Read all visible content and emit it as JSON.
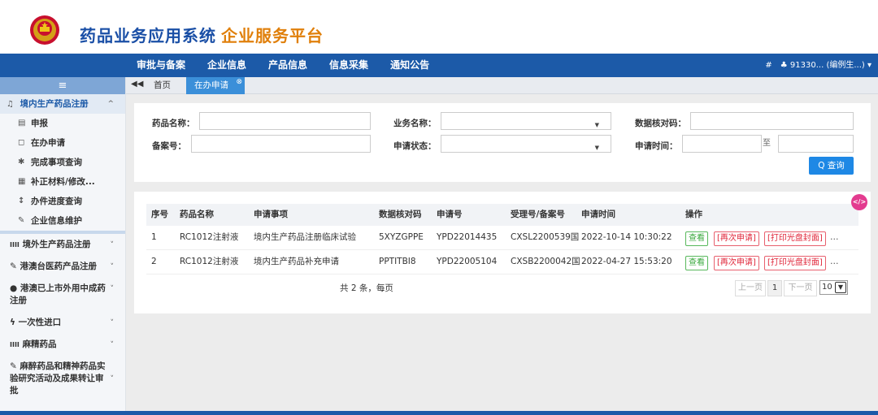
{
  "header": {
    "title": "药品业务应用系统",
    "subtitle": "企业服务平台"
  },
  "topnav": {
    "items": [
      "审批与备案",
      "企业信息",
      "产品信息",
      "信息采集",
      "通知公告"
    ],
    "home_icon": "#",
    "user": "♣ 91330... (编例生...) ▾"
  },
  "sidebar": {
    "toggle": "≡",
    "groups": [
      {
        "icon": "bell-icon",
        "label": "境内生产药品注册",
        "open": true,
        "items": [
          {
            "icon": "▤",
            "label": "申报"
          },
          {
            "icon": "◻",
            "label": "在办申请"
          },
          {
            "icon": "✱",
            "label": "完成事项查询"
          },
          {
            "icon": "▦",
            "label": "补正材料/修改..."
          },
          {
            "icon": "↕",
            "label": "办件进度查询"
          },
          {
            "icon": "✎",
            "label": "企业信息维护"
          }
        ]
      },
      {
        "icon": "IIII",
        "label": "境外生产药品注册"
      },
      {
        "icon": "✎",
        "label": "港澳台医药产品注册"
      },
      {
        "icon": "●",
        "label": "港澳已上市外用中成药注册"
      },
      {
        "icon": "ϟ",
        "label": "一次性进口"
      },
      {
        "icon": "IIII",
        "label": "麻精药品"
      },
      {
        "icon": "✎",
        "label": "麻醉药品和精神药品实验研究活动及成果转让审批"
      }
    ]
  },
  "tabs": {
    "back": "◀◀",
    "home": "首页",
    "active": "在办申请",
    "close": "⊗"
  },
  "search": {
    "drug_name_label": "药品名称：",
    "business_label": "业务名称：",
    "data_code_label": "数据核对码：",
    "record_no_label": "备案号：",
    "status_label": "申请状态：",
    "time_label": "申请时间：",
    "to_label": "至",
    "search_btn": "Q 查询"
  },
  "table": {
    "columns": [
      "序号",
      "药品名称",
      "申请事项",
      "数据核对码",
      "申请号",
      "受理号/备案号",
      "申请时间",
      "操作"
    ],
    "rows": [
      {
        "no": "1",
        "name": "RC1012注射液",
        "item": "境内生产药品注册临床试验",
        "code": "5XYZGPPE",
        "app_no": "YPD22014435",
        "accept_no": "CXSL2200539国",
        "time": "2022-10-14 10:30:22"
      },
      {
        "no": "2",
        "name": "RC1012注射液",
        "item": "境内生产药品补充申请",
        "code": "PPTITBI8",
        "app_no": "YPD22005104",
        "accept_no": "CXSB2200042国",
        "time": "2022-04-27 15:53:20"
      }
    ],
    "actions": {
      "view": "查看",
      "reapply": "[再次申请]",
      "print": "[打印光盘封面]",
      "more": "..."
    }
  },
  "pagination": {
    "summary": "共 2 条，每页",
    "prev": "上一页",
    "page": "1",
    "next": "下一页",
    "size": "10"
  },
  "float_btn": "</>",
  "colors": {
    "nav": "#1c5aa8",
    "brand_blue": "#1a4fa6",
    "brand_orange": "#e07f0a",
    "accent": "#1e88e5"
  }
}
